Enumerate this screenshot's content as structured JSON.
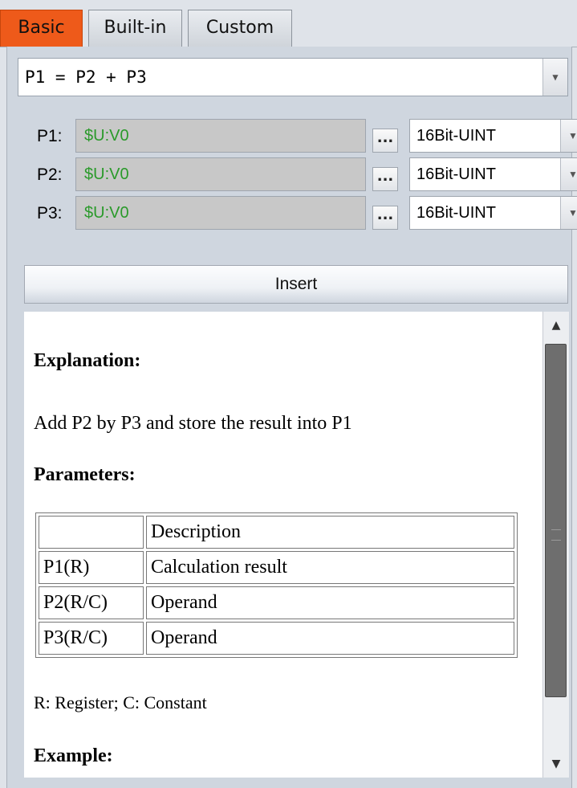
{
  "tabs": [
    {
      "label": "Basic",
      "active": true
    },
    {
      "label": "Built-in",
      "active": false
    },
    {
      "label": "Custom",
      "active": false
    }
  ],
  "formula": {
    "value": "P1 = P2 + P3"
  },
  "params": [
    {
      "label": "P1:",
      "address": "$U:V0",
      "browse": "...",
      "type": "16Bit-UINT"
    },
    {
      "label": "P2:",
      "address": "$U:V0",
      "browse": "...",
      "type": "16Bit-UINT"
    },
    {
      "label": "P3:",
      "address": "$U:V0",
      "browse": "...",
      "type": "16Bit-UINT"
    }
  ],
  "insert_label": "Insert",
  "doc": {
    "explanation_title": "Explanation:",
    "explanation_text": "Add P2 by P3 and store the result into P1",
    "parameters_title": "Parameters:",
    "table": [
      [
        "",
        "Description"
      ],
      [
        "P1(R)",
        "Calculation result"
      ],
      [
        "P2(R/C)",
        "Operand"
      ],
      [
        "P3(R/C)",
        "Operand"
      ]
    ],
    "legend": "R: Register; C: Constant",
    "example_title": "Example:"
  },
  "colors": {
    "active_tab": "#ee5a1a",
    "address_text": "#2a9a2a"
  },
  "icons": {
    "dropdown": "chevron-down-icon",
    "scroll_up": "arrow-up-icon",
    "scroll_down": "arrow-down-icon"
  }
}
